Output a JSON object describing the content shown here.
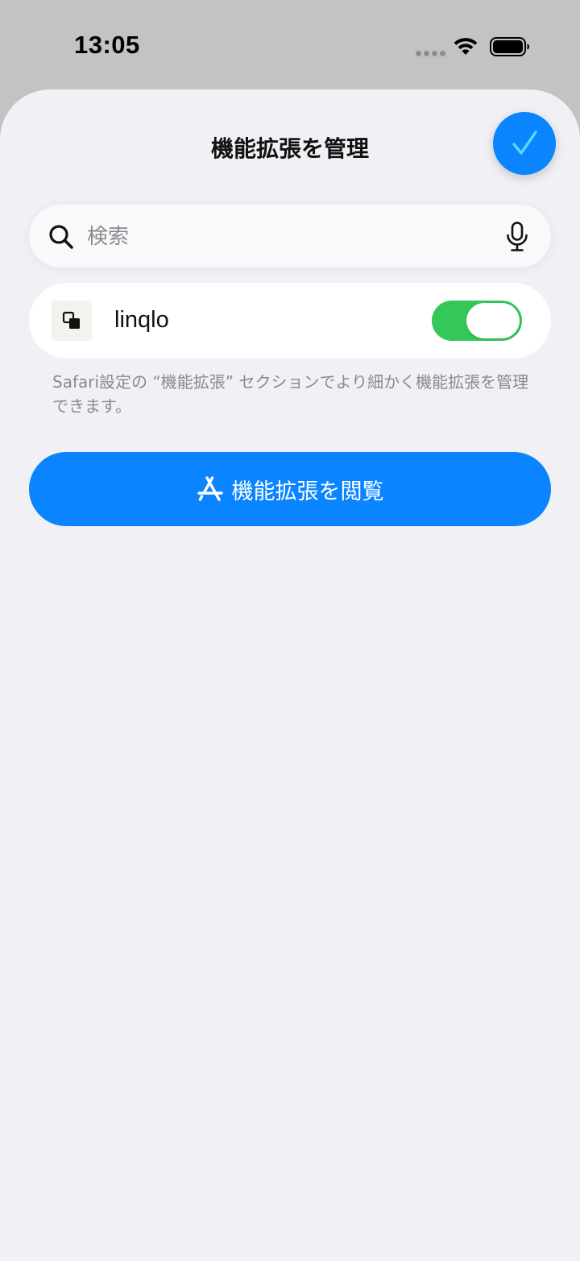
{
  "status_bar": {
    "time": "13:05"
  },
  "sheet": {
    "title": "機能拡張を管理",
    "done_icon": "checkmark-icon"
  },
  "search": {
    "placeholder": "検索",
    "value": ""
  },
  "extensions": [
    {
      "name": "linqlo",
      "enabled": true
    }
  ],
  "footnote": "Safari設定の “機能拡張” セクションでより細かく機能拡張を管理できます。",
  "browse_button": {
    "label": "機能拡張を閲覧",
    "icon": "app-store-icon"
  },
  "colors": {
    "accent": "#0a84ff",
    "toggle_on": "#34c759",
    "check": "#5ad8ff",
    "sheet_bg": "#f0f0f5",
    "backdrop": "#c3c3c3"
  }
}
